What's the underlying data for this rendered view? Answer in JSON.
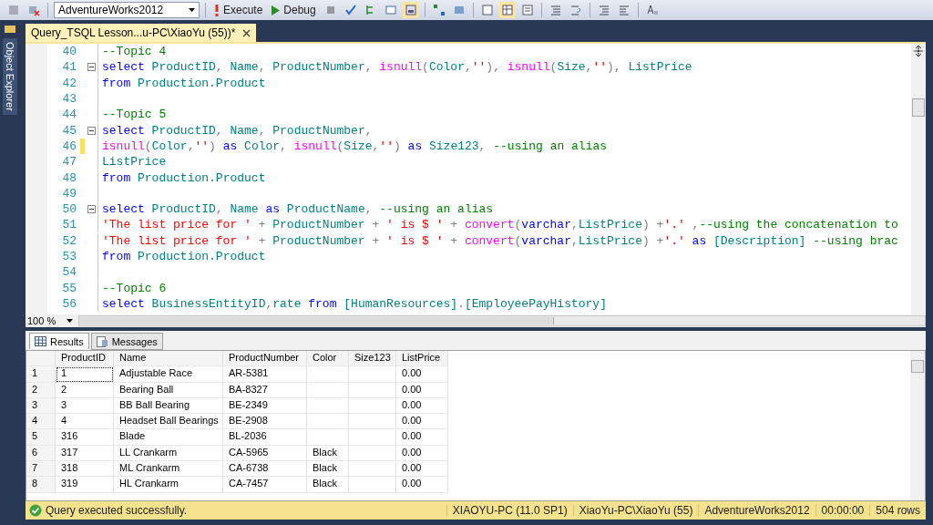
{
  "toolbar": {
    "database": "AdventureWorks2012",
    "buttons": [
      {
        "label": "Execute",
        "kind": "execute"
      },
      {
        "label": "Debug",
        "kind": "debug"
      }
    ]
  },
  "side_panel": {
    "label": "Object Explorer"
  },
  "document_tab": {
    "title": "Query_TSQL Lesson...u-PC\\XiaoYu (55))*",
    "selected": true
  },
  "editor": {
    "lines": [
      {
        "number": "40",
        "fold": false,
        "changed": false,
        "segments": [
          {
            "text": "--Topic 4",
            "kind": "cm"
          }
        ]
      },
      {
        "number": "41",
        "fold": true,
        "changed": false,
        "segments": [
          {
            "text": "select",
            "kind": "kw"
          },
          {
            "text": " ProductID",
            "kind": "id"
          },
          {
            "text": ",",
            "kind": "op"
          },
          {
            "text": " Name",
            "kind": "id"
          },
          {
            "text": ",",
            "kind": "op"
          },
          {
            "text": " ProductNumber",
            "kind": "id"
          },
          {
            "text": ",",
            "kind": "op"
          },
          {
            "text": " isnull",
            "kind": "fn"
          },
          {
            "text": "(",
            "kind": "op"
          },
          {
            "text": "Color",
            "kind": "id"
          },
          {
            "text": ",",
            "kind": "op"
          },
          {
            "text": "''",
            "kind": "str"
          },
          {
            "text": "),",
            "kind": "op"
          },
          {
            "text": " isnull",
            "kind": "fn"
          },
          {
            "text": "(",
            "kind": "op"
          },
          {
            "text": "Size",
            "kind": "id"
          },
          {
            "text": ",",
            "kind": "op"
          },
          {
            "text": "''",
            "kind": "str"
          },
          {
            "text": "),",
            "kind": "op"
          },
          {
            "text": " ListPrice",
            "kind": "id"
          }
        ]
      },
      {
        "number": "42",
        "fold": false,
        "changed": false,
        "segments": [
          {
            "text": "from",
            "kind": "kw"
          },
          {
            "text": " Production.Product",
            "kind": "id"
          }
        ]
      },
      {
        "number": "43",
        "fold": false,
        "changed": false
      },
      {
        "number": "44",
        "fold": false,
        "changed": false,
        "segments": [
          {
            "text": "--Topic 5",
            "kind": "cm"
          }
        ]
      },
      {
        "number": "45",
        "fold": true,
        "changed": false,
        "segments": [
          {
            "text": "select",
            "kind": "kw"
          },
          {
            "text": " ProductID",
            "kind": "id"
          },
          {
            "text": ",",
            "kind": "op"
          },
          {
            "text": " Name",
            "kind": "id"
          },
          {
            "text": ",",
            "kind": "op"
          },
          {
            "text": " ProductNumber",
            "kind": "id"
          },
          {
            "text": ",",
            "kind": "op"
          }
        ]
      },
      {
        "number": "46",
        "fold": false,
        "changed": true,
        "segments": [
          {
            "text": "isnull",
            "kind": "fn"
          },
          {
            "text": "(",
            "kind": "op"
          },
          {
            "text": "Color",
            "kind": "id"
          },
          {
            "text": ",",
            "kind": "op"
          },
          {
            "text": "''",
            "kind": "str"
          },
          {
            "text": ")",
            "kind": "op"
          },
          {
            "text": " as",
            "kind": "kw"
          },
          {
            "text": " Color",
            "kind": "id"
          },
          {
            "text": ",",
            "kind": "op"
          },
          {
            "text": " isnull",
            "kind": "fn"
          },
          {
            "text": "(",
            "kind": "op"
          },
          {
            "text": "Size",
            "kind": "id"
          },
          {
            "text": ",",
            "kind": "op"
          },
          {
            "text": "''",
            "kind": "str"
          },
          {
            "text": ")",
            "kind": "op"
          },
          {
            "text": " as",
            "kind": "kw"
          },
          {
            "text": " Size123",
            "kind": "id"
          },
          {
            "text": ",",
            "kind": "op"
          },
          {
            "text": " --using an alias",
            "kind": "cm"
          }
        ]
      },
      {
        "number": "47",
        "fold": false,
        "changed": false,
        "segments": [
          {
            "text": "ListPrice",
            "kind": "id"
          }
        ]
      },
      {
        "number": "48",
        "fold": false,
        "changed": false,
        "segments": [
          {
            "text": "from",
            "kind": "kw"
          },
          {
            "text": " Production.Product",
            "kind": "id"
          }
        ]
      },
      {
        "number": "49",
        "fold": false,
        "changed": false
      },
      {
        "number": "50",
        "fold": true,
        "changed": false,
        "segments": [
          {
            "text": "select",
            "kind": "kw"
          },
          {
            "text": " ProductID",
            "kind": "id"
          },
          {
            "text": ",",
            "kind": "op"
          },
          {
            "text": " Name",
            "kind": "id"
          },
          {
            "text": " as",
            "kind": "kw"
          },
          {
            "text": " ProductName",
            "kind": "id"
          },
          {
            "text": ",",
            "kind": "op"
          },
          {
            "text": " --using an alias",
            "kind": "cm"
          }
        ]
      },
      {
        "number": "51",
        "fold": false,
        "changed": false,
        "segments": [
          {
            "text": "'The list price for '",
            "kind": "str"
          },
          {
            "text": " +",
            "kind": "op"
          },
          {
            "text": " ProductNumber",
            "kind": "id"
          },
          {
            "text": " +",
            "kind": "op"
          },
          {
            "text": " ' is $ '",
            "kind": "str"
          },
          {
            "text": " +",
            "kind": "op"
          },
          {
            "text": " convert",
            "kind": "fn"
          },
          {
            "text": "(",
            "kind": "op"
          },
          {
            "text": "varchar",
            "kind": "kw"
          },
          {
            "text": ",",
            "kind": "op"
          },
          {
            "text": "ListPrice",
            "kind": "id"
          },
          {
            "text": ")",
            "kind": "op"
          },
          {
            "text": " +",
            "kind": "op"
          },
          {
            "text": "'.'",
            "kind": "str"
          },
          {
            "text": " ,",
            "kind": "op"
          },
          {
            "text": "--using the concatenation to",
            "kind": "cm"
          }
        ]
      },
      {
        "number": "52",
        "fold": false,
        "changed": false,
        "segments": [
          {
            "text": "'The list price for '",
            "kind": "str"
          },
          {
            "text": " +",
            "kind": "op"
          },
          {
            "text": " ProductNumber",
            "kind": "id"
          },
          {
            "text": " +",
            "kind": "op"
          },
          {
            "text": " ' is $ '",
            "kind": "str"
          },
          {
            "text": " +",
            "kind": "op"
          },
          {
            "text": " convert",
            "kind": "fn"
          },
          {
            "text": "(",
            "kind": "op"
          },
          {
            "text": "varchar",
            "kind": "kw"
          },
          {
            "text": ",",
            "kind": "op"
          },
          {
            "text": "ListPrice",
            "kind": "id"
          },
          {
            "text": ")",
            "kind": "op"
          },
          {
            "text": " +",
            "kind": "op"
          },
          {
            "text": "'.'",
            "kind": "str"
          },
          {
            "text": " as",
            "kind": "kw"
          },
          {
            "text": " [Description]",
            "kind": "id"
          },
          {
            "text": " --using brac",
            "kind": "cm"
          }
        ]
      },
      {
        "number": "53",
        "fold": false,
        "changed": false,
        "segments": [
          {
            "text": "from",
            "kind": "kw"
          },
          {
            "text": " Production.Product",
            "kind": "id"
          }
        ]
      },
      {
        "number": "54",
        "fold": false,
        "changed": false
      },
      {
        "number": "55",
        "fold": false,
        "changed": false,
        "segments": [
          {
            "text": "--Topic 6",
            "kind": "cm"
          }
        ]
      },
      {
        "number": "56",
        "fold": false,
        "changed": false,
        "segments": [
          {
            "text": "select",
            "kind": "kw"
          },
          {
            "text": " BusinessEntityID",
            "kind": "id"
          },
          {
            "text": ",",
            "kind": "op"
          },
          {
            "text": "rate",
            "kind": "id"
          },
          {
            "text": " from",
            "kind": "kw"
          },
          {
            "text": " [HumanResources]",
            "kind": "id"
          },
          {
            "text": ".",
            "kind": "op"
          },
          {
            "text": "[EmployeePayHistory]",
            "kind": "id"
          }
        ]
      }
    ]
  },
  "zoom": "100 %",
  "result_tabs": [
    {
      "label": "Results",
      "selected": true,
      "kind": "grid"
    },
    {
      "label": "Messages",
      "selected": false,
      "kind": "messages"
    }
  ],
  "grid": {
    "columns": [
      "ProductID",
      "Name",
      "ProductNumber",
      "Color",
      "Size123",
      "ListPrice"
    ],
    "rows": [
      {
        "number": "1",
        "focused": true,
        "cells": [
          "1",
          "Adjustable Race",
          "AR-5381",
          "",
          "",
          "0.00"
        ]
      },
      {
        "number": "2",
        "focused": false,
        "cells": [
          "2",
          "Bearing Ball",
          "BA-8327",
          "",
          "",
          "0.00"
        ]
      },
      {
        "number": "3",
        "focused": false,
        "cells": [
          "3",
          "BB Ball Bearing",
          "BE-2349",
          "",
          "",
          "0.00"
        ]
      },
      {
        "number": "4",
        "focused": false,
        "cells": [
          "4",
          "Headset Ball Bearings",
          "BE-2908",
          "",
          "",
          "0.00"
        ]
      },
      {
        "number": "5",
        "focused": false,
        "cells": [
          "316",
          "Blade",
          "BL-2036",
          "",
          "",
          "0.00"
        ]
      },
      {
        "number": "6",
        "focused": false,
        "cells": [
          "317",
          "LL Crankarm",
          "CA-5965",
          "Black",
          "",
          "0.00"
        ]
      },
      {
        "number": "7",
        "focused": false,
        "cells": [
          "318",
          "ML Crankarm",
          "CA-6738",
          "Black",
          "",
          "0.00"
        ]
      },
      {
        "number": "8",
        "focused": false,
        "cells": [
          "319",
          "HL Crankarm",
          "CA-7457",
          "Black",
          "",
          "0.00"
        ]
      }
    ]
  },
  "status_bar": {
    "message": "Query executed successfully.",
    "items": [
      "XIAOYU-PC (11.0 SP1)",
      "XiaoYu-PC\\XiaoYu (55)",
      "AdventureWorks2012",
      "00:00:00",
      "504 rows"
    ]
  }
}
